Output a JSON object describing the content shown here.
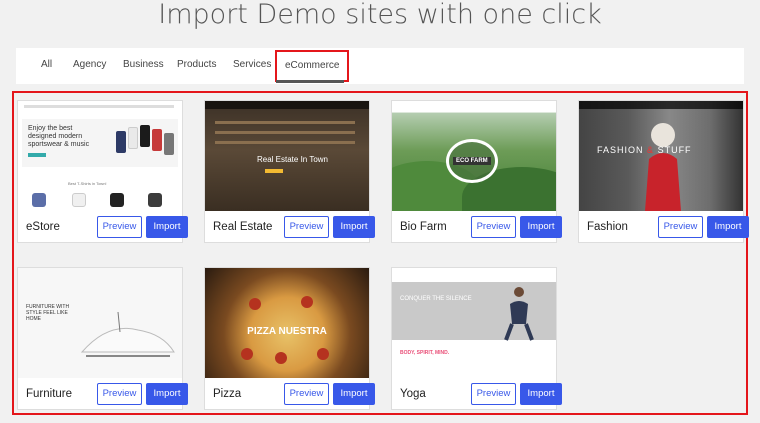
{
  "page": {
    "title": "Import Demo sites with one click"
  },
  "tabs": [
    {
      "label": "All"
    },
    {
      "label": "Agency"
    },
    {
      "label": "Business"
    },
    {
      "label": "Products"
    },
    {
      "label": "Services"
    },
    {
      "label": "eCommerce",
      "active": true
    }
  ],
  "cards": [
    {
      "name": "eStore",
      "preview_label": "Preview",
      "import_label": "Import",
      "thumb_text": "Enjoy the best designed modern sportswear & music",
      "thumb_sub": "Best T-Shirts in Town!"
    },
    {
      "name": "Real Estate",
      "preview_label": "Preview",
      "import_label": "Import",
      "thumb_text": "Real Estate In Town"
    },
    {
      "name": "Bio Farm",
      "preview_label": "Preview",
      "import_label": "Import",
      "thumb_text": "ECO FARM"
    },
    {
      "name": "Fashion",
      "preview_label": "Preview",
      "import_label": "Import",
      "thumb_text_a": "FASHION",
      "thumb_text_x": "&",
      "thumb_text_b": "STUFF"
    },
    {
      "name": "Furniture",
      "preview_label": "Preview",
      "import_label": "Import",
      "thumb_text": "FURNITURE WITH STYLE FEEL LIKE HOME"
    },
    {
      "name": "Pizza",
      "preview_label": "Preview",
      "import_label": "Import",
      "thumb_text": "PIZZA NUESTRA"
    },
    {
      "name": "Yoga",
      "preview_label": "Preview",
      "import_label": "Import",
      "thumb_text": "CONQUER THE SILENCE",
      "thumb_sub": "BODY, SPIRIT, MIND."
    }
  ],
  "colors": {
    "accent": "#3858e9",
    "highlight": "#e4161b"
  }
}
